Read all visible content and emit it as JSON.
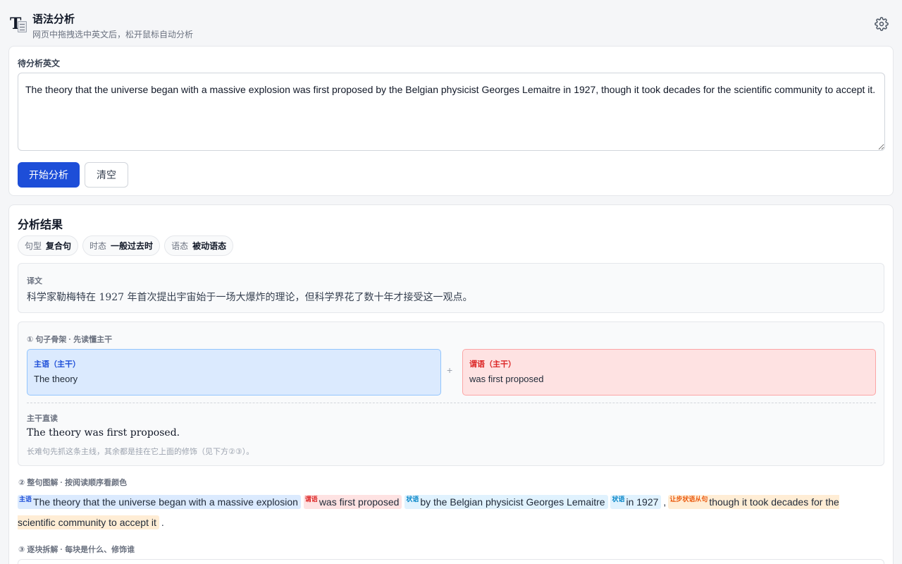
{
  "header": {
    "title": "语法分析",
    "subtitle": "网页中拖拽选中英文后，松开鼠标自动分析",
    "logo_icon": "text-document-icon",
    "settings_icon": "gear-icon"
  },
  "input": {
    "label": "待分析英文",
    "value": "The theory that the universe began with a massive explosion was first proposed by the Belgian physicist Georges Lemaitre in 1927, though it took decades for the scientific community to accept it.",
    "analyze_label": "开始分析",
    "clear_label": "清空"
  },
  "result": {
    "title": "分析结果",
    "tags": [
      {
        "key": "句型",
        "value": "复合句"
      },
      {
        "key": "时态",
        "value": "一般过去时"
      },
      {
        "key": "语态",
        "value": "被动语态"
      }
    ],
    "translation_label": "译文",
    "translation": "科学家勒梅特在 1927 年首次提出宇宙始于一场大爆炸的理论，但科学界花了数十年才接受这一观点。",
    "skeleton": {
      "title": "① 句子骨架 · 先读懂主干",
      "subject_label": "主语（主干）",
      "subject_value": "The theory",
      "plus": "+",
      "predicate_label": "谓语（主干）",
      "predicate_value": "was first proposed",
      "core_label": "主干直读",
      "core_text": "The theory was first proposed.",
      "core_note": "长难句先抓这条主线，其余都是挂在它上面的修饰（见下方②③）。"
    },
    "diagram": {
      "title": "② 整句图解 · 按阅读顺序看颜色",
      "chunks": [
        {
          "tag": "主语",
          "text": "The theory that the universe began with a massive explosion"
        },
        {
          "tag": "谓语",
          "text": "was first proposed"
        },
        {
          "tag": "状语",
          "text": "by the Belgian physicist Georges Lemaitre"
        },
        {
          "tag": "状语",
          "text": "in 1927"
        },
        {
          "tag": "让步状语从句",
          "text": "though it took decades for the scientific community to accept it"
        }
      ],
      "comma": ",",
      "period": "."
    },
    "blocks": {
      "title": "③ 逐块拆解 · 每块是什么、修饰谁"
    }
  }
}
